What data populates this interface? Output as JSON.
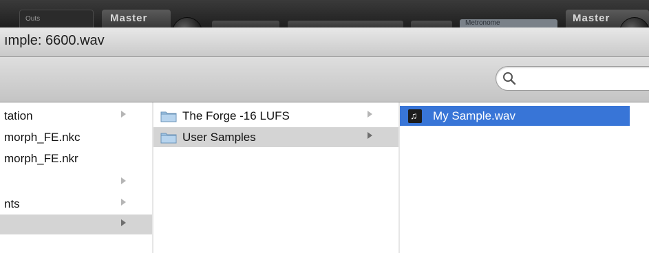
{
  "background_app": {
    "output_tab_label": "Outs",
    "master_labels": [
      "Master",
      "Master"
    ],
    "metronome_label": "Metronome"
  },
  "dialog": {
    "title": "ımple: 6600.wav",
    "search": {
      "value": "",
      "placeholder": ""
    }
  },
  "columns": {
    "col1": [
      {
        "label": "tation",
        "has_children": true,
        "selected": false
      },
      {
        "label": "morph_FE.nkc",
        "has_children": false,
        "selected": false
      },
      {
        "label": "morph_FE.nkr",
        "has_children": false,
        "selected": false
      },
      {
        "label": "",
        "has_children": true,
        "selected": false
      },
      {
        "label": "nts",
        "has_children": true,
        "selected": false
      },
      {
        "label": "",
        "has_children": true,
        "selected": true
      }
    ],
    "col2": [
      {
        "label": "The Forge -16 LUFS",
        "icon": "folder-icon",
        "has_children": true,
        "selected": false
      },
      {
        "label": "User Samples",
        "icon": "folder-icon",
        "has_children": true,
        "selected": true
      }
    ],
    "col3": [
      {
        "label": "My Sample.wav",
        "icon": "audio-file-icon",
        "selected": true
      }
    ]
  },
  "colors": {
    "selection_blue": "#3875d7",
    "selection_gray": "#d4d4d4"
  }
}
